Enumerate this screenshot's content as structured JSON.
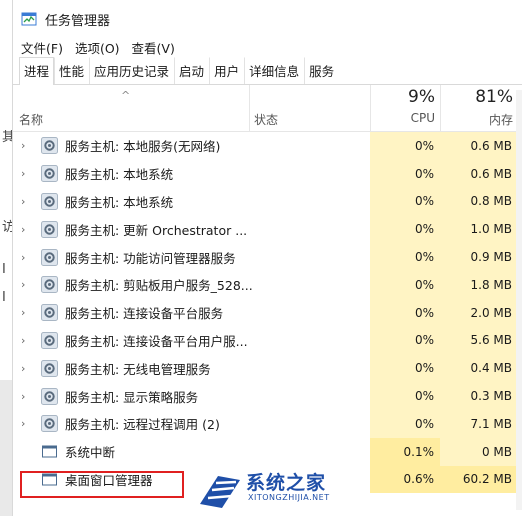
{
  "window": {
    "title": "任务管理器",
    "icon": "task-manager-icon"
  },
  "menu": [
    "文件(F)",
    "选项(O)",
    "查看(V)"
  ],
  "tabs": [
    "进程",
    "性能",
    "应用历史记录",
    "启动",
    "用户",
    "详细信息",
    "服务"
  ],
  "active_tab": "进程",
  "columns": {
    "name": "名称",
    "status": "状态",
    "cpu_pct": "9%",
    "cpu_label": "CPU",
    "mem_pct": "81%",
    "mem_label": "内存"
  },
  "processes": [
    {
      "name": "服务主机: 本地服务(无网络)",
      "cpu": "0%",
      "mem": "0.6 MB",
      "expand": true,
      "icon": "gear-icon"
    },
    {
      "name": "服务主机: 本地系统",
      "cpu": "0%",
      "mem": "0.6 MB",
      "expand": true,
      "icon": "gear-icon"
    },
    {
      "name": "服务主机: 本地系统",
      "cpu": "0%",
      "mem": "0.8 MB",
      "expand": true,
      "icon": "gear-icon"
    },
    {
      "name": "服务主机: 更新 Orchestrator ...",
      "cpu": "0%",
      "mem": "1.0 MB",
      "expand": true,
      "icon": "gear-icon"
    },
    {
      "name": "服务主机: 功能访问管理器服务",
      "cpu": "0%",
      "mem": "0.9 MB",
      "expand": true,
      "icon": "gear-icon"
    },
    {
      "name": "服务主机: 剪贴板用户服务_528...",
      "cpu": "0%",
      "mem": "1.8 MB",
      "expand": true,
      "icon": "gear-icon"
    },
    {
      "name": "服务主机: 连接设备平台服务",
      "cpu": "0%",
      "mem": "2.0 MB",
      "expand": true,
      "icon": "gear-icon"
    },
    {
      "name": "服务主机: 连接设备平台用户服...",
      "cpu": "0%",
      "mem": "5.6 MB",
      "expand": true,
      "icon": "gear-icon"
    },
    {
      "name": "服务主机: 无线电管理服务",
      "cpu": "0%",
      "mem": "0.4 MB",
      "expand": true,
      "icon": "gear-icon"
    },
    {
      "name": "服务主机: 显示策略服务",
      "cpu": "0%",
      "mem": "0.3 MB",
      "expand": true,
      "icon": "gear-icon"
    },
    {
      "name": "服务主机: 远程过程调用 (2)",
      "cpu": "0%",
      "mem": "7.1 MB",
      "expand": true,
      "icon": "gear-icon"
    },
    {
      "name": "系统中断",
      "cpu": "0.1%",
      "mem": "0 MB",
      "expand": false,
      "icon": "window-icon"
    },
    {
      "name": "桌面窗口管理器",
      "cpu": "0.6%",
      "mem": "60.2 MB",
      "expand": false,
      "icon": "window-icon"
    }
  ],
  "left_fragments": [
    "其",
    "访",
    "I",
    "I"
  ],
  "watermark": {
    "text": "系统之家",
    "url": "XITONGZHIJIA.NET"
  },
  "colors": {
    "cell_bg": "#fff4c4",
    "cell_bg_strong": "#ffeda0",
    "highlight": "#e02020",
    "watermark": "#1f4fa8"
  }
}
